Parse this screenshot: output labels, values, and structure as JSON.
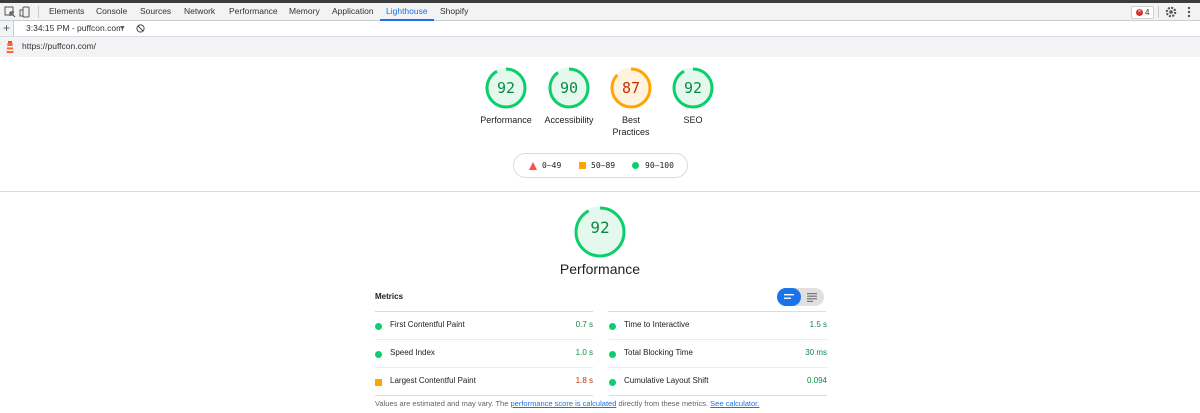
{
  "devtools": {
    "tabs": [
      "Elements",
      "Console",
      "Sources",
      "Network",
      "Performance",
      "Memory",
      "Application",
      "Lighthouse",
      "Shopify"
    ],
    "active_tab": "Lighthouse",
    "error_count": "4"
  },
  "report_bar": {
    "report_label": "3:34:15 PM - puffcon.com",
    "plus": "+",
    "caret": "▼"
  },
  "url": "https://puffcon.com/",
  "colors": {
    "pass": "#0cce6b",
    "average": "#ffa400",
    "fail": "#ff4e42",
    "accent": "#1a73e8"
  },
  "gauges": [
    {
      "score": "92",
      "label": "Performance",
      "level": "pass"
    },
    {
      "score": "90",
      "label": "Accessibility",
      "level": "pass"
    },
    {
      "score": "87",
      "label": "Best Practices",
      "level": "average"
    },
    {
      "score": "92",
      "label": "SEO",
      "level": "pass"
    }
  ],
  "legend": [
    {
      "range": "0–49",
      "shape": "triangle",
      "level": "fail"
    },
    {
      "range": "50–89",
      "shape": "square",
      "level": "average"
    },
    {
      "range": "90–100",
      "shape": "circle",
      "level": "pass"
    }
  ],
  "performance": {
    "score": "92",
    "title": "Performance",
    "metrics_title": "Metrics"
  },
  "metrics": [
    {
      "name": "First Contentful Paint",
      "value": "0.7 s",
      "level": "pass"
    },
    {
      "name": "Time to Interactive",
      "value": "1.5 s",
      "level": "pass"
    },
    {
      "name": "Speed Index",
      "value": "1.0 s",
      "level": "pass"
    },
    {
      "name": "Total Blocking Time",
      "value": "30 ms",
      "level": "pass"
    },
    {
      "name": "Largest Contentful Paint",
      "value": "1.8 s",
      "level": "average"
    },
    {
      "name": "Cumulative Layout Shift",
      "value": "0.094",
      "level": "pass"
    }
  ],
  "footnote": {
    "prefix": "Values are estimated and may vary. The ",
    "link1": "performance score is calculated",
    "middle": " directly from these metrics. ",
    "link2": "See calculator."
  }
}
